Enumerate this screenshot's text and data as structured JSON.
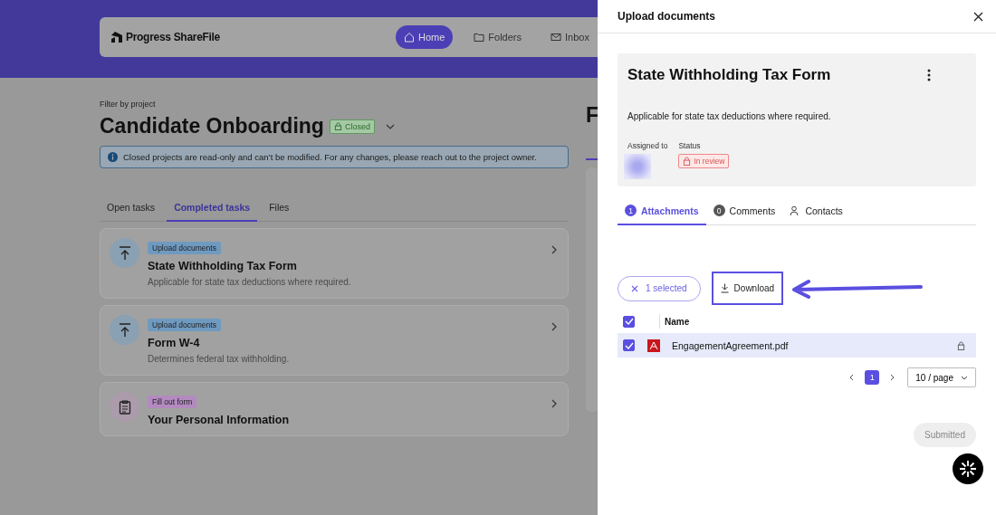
{
  "header": {
    "logo": "Progress ShareFile",
    "nav": [
      {
        "label": "Home",
        "selected": true
      },
      {
        "label": "Folders",
        "selected": false
      },
      {
        "label": "Inbox",
        "selected": false
      }
    ]
  },
  "project": {
    "filter_label": "Filter by project",
    "title": "Candidate Onboarding",
    "badge": "Closed",
    "alert": "Closed projects are read-only and can’t be modified. For any changes, please reach out to the project owner."
  },
  "tabs": [
    {
      "label": "Open tasks",
      "selected": false
    },
    {
      "label": "Completed tasks",
      "selected": true
    },
    {
      "label": "Files",
      "selected": false
    }
  ],
  "tasks": [
    {
      "kind": "upload",
      "tag": "Upload documents",
      "title": "State Withholding Tax Form",
      "description": "Applicable for state tax deductions where required."
    },
    {
      "kind": "upload",
      "tag": "Upload documents",
      "title": "Form W-4",
      "description": "Determines federal tax withholding."
    },
    {
      "kind": "form",
      "tag": "Fill out form",
      "title": "Your Personal Information"
    }
  ],
  "right_column": {
    "title": "F"
  },
  "panel": {
    "title": "Upload documents",
    "task": {
      "title": "State Withholding Tax Form",
      "description": "Applicable for state tax deductions where required.",
      "assigned_label": "Assigned to",
      "status_label": "Status",
      "status": "In review"
    },
    "tabs": [
      {
        "label": "Attachments",
        "count": "1",
        "selected": true
      },
      {
        "label": "Comments",
        "count": "0",
        "selected": false
      },
      {
        "label": "Contacts",
        "selected": false
      }
    ],
    "selection": "1 selected",
    "download": {
      "label": "Download",
      "highlighted": true
    },
    "table": {
      "columns": [
        "Name"
      ],
      "all_checked": true,
      "rows": [
        {
          "name": "EngagementAgreement.pdf",
          "checked": true,
          "selected": true,
          "locked": true
        }
      ]
    },
    "pagination": {
      "pages": [
        {
          "label": "1",
          "selected": true
        }
      ],
      "page_size": "10 / page"
    },
    "submit": "Submitted"
  }
}
